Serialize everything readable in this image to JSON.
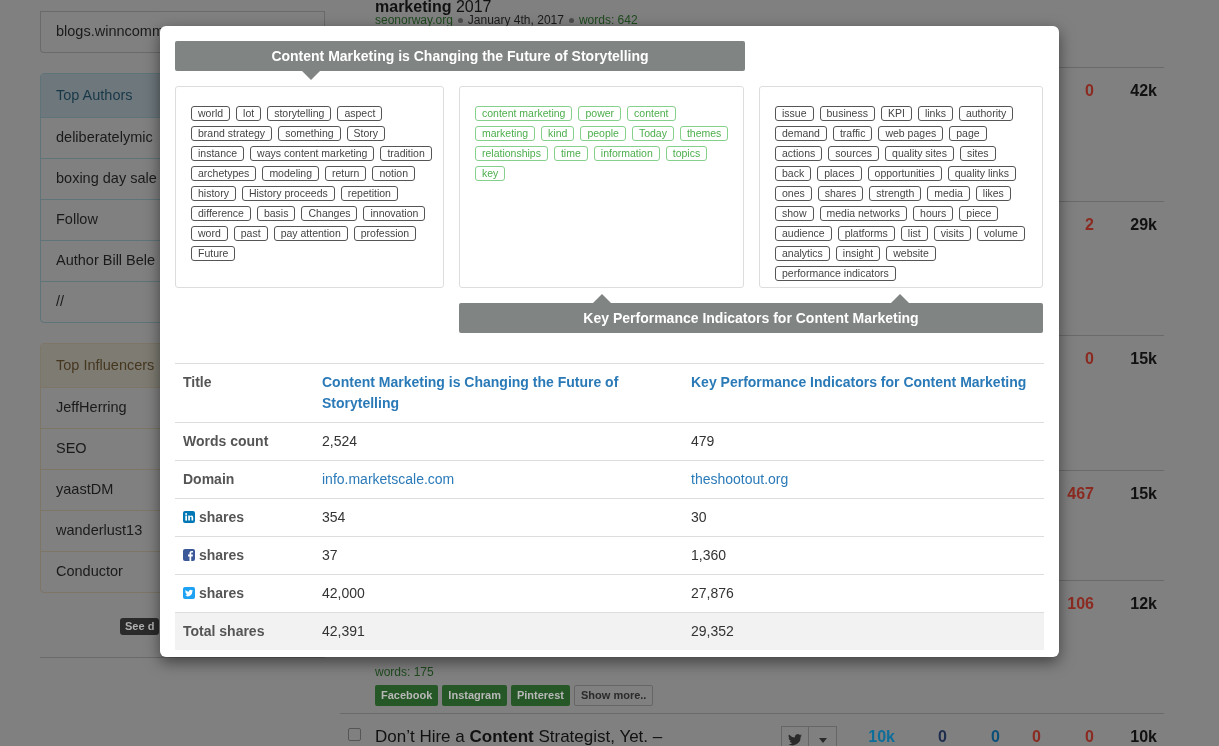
{
  "sidebar": {
    "domain_item": "blogs.winncomm",
    "top_authors": {
      "title": "Top Authors",
      "items": [
        "deliberatelymic",
        "boxing day sale",
        "Follow",
        "Author Bill Bele",
        "//"
      ]
    },
    "top_influencers": {
      "title": "Top Influencers",
      "items": [
        "JeffHerring",
        "SEO",
        "yaastDM",
        "wanderlust13",
        "Conductor"
      ]
    },
    "see_details_button": "See d"
  },
  "feed": {
    "top_post": {
      "title": "**marketing** 2017",
      "domain": "seonorway.org",
      "date": "January 4th, 2017",
      "words": "words: 642"
    },
    "rows": [
      {
        "count": "0",
        "total": "42k"
      },
      {
        "count": "2",
        "total": "29k"
      },
      {
        "count": "0",
        "total": "15k"
      },
      {
        "count": "467",
        "total": "15k"
      },
      {
        "count": "106",
        "total": "12k"
      }
    ],
    "row_tail": {
      "words": "words: 175",
      "tags": [
        "Facebook",
        "Instagram",
        "Pinterest"
      ],
      "show_more": "Show more.."
    },
    "next_post": {
      "title": "Don’t Hire a **Content** Strategist, Yet. –",
      "checked": false,
      "counts": [
        {
          "text": "10k",
          "color": "#0d6e9a"
        },
        {
          "text": "0",
          "color": "#1e2d4d"
        },
        {
          "text": "0",
          "color": "#0a4f78"
        },
        {
          "text": "0",
          "color": "#8b2a20"
        },
        {
          "text": "0",
          "color": "#8b2a20"
        },
        {
          "text": "10k",
          "color": "#111111"
        }
      ]
    }
  },
  "comparison_modal": {
    "top_title": "Content Marketing is Changing the Future of Storytelling",
    "bottom_title": "Key Performance Indicators for Content Marketing",
    "tag_clouds": [
      {
        "kind": "own",
        "tags": [
          "world",
          "lot",
          "storytelling",
          "aspect",
          "brand strategy",
          "something",
          "Story",
          "instance",
          "ways content marketing",
          "tradition",
          "archetypes",
          "modeling",
          "return",
          "notion",
          "history",
          "History proceeds",
          "repetition",
          "difference",
          "basis",
          "Changes",
          "innovation",
          "word",
          "past",
          "pay attention",
          "profession",
          "Future"
        ]
      },
      {
        "kind": "shared",
        "tags": [
          "content marketing",
          "power",
          "content",
          "marketing",
          "kind",
          "people",
          "Today",
          "themes",
          "relationships",
          "time",
          "information",
          "topics",
          "key"
        ]
      },
      {
        "kind": "own",
        "tags": [
          "issue",
          "business",
          "KPI",
          "links",
          "authority",
          "demand",
          "traffic",
          "web pages",
          "page",
          "actions",
          "sources",
          "quality sites",
          "sites",
          "back",
          "places",
          "opportunities",
          "quality links",
          "ones",
          "shares",
          "strength",
          "media",
          "likes",
          "show",
          "media networks",
          "hours",
          "piece",
          "audience",
          "platforms",
          "list",
          "visits",
          "volume",
          "analytics",
          "insight",
          "website",
          "performance indicators"
        ]
      }
    ],
    "table": [
      {
        "kind": "title",
        "label": "Title",
        "values": [
          "Content Marketing is Changing the Future of Storytelling",
          "Key Performance Indicators for Content Marketing"
        ]
      },
      {
        "kind": "plain",
        "label": "Words count",
        "values": [
          "2,524",
          "479"
        ]
      },
      {
        "kind": "link",
        "label": "Domain",
        "values": [
          "info.marketscale.com",
          "theshootout.org"
        ]
      },
      {
        "kind": "linkedin",
        "label": "shares",
        "values": [
          "354",
          "30"
        ]
      },
      {
        "kind": "facebook",
        "label": "shares",
        "values": [
          "37",
          "1,360"
        ]
      },
      {
        "kind": "twitter",
        "label": "shares",
        "values": [
          "42,000",
          "27,876"
        ]
      },
      {
        "kind": "total",
        "label": "Total shares",
        "values": [
          "42,391",
          "29,352"
        ]
      }
    ]
  }
}
